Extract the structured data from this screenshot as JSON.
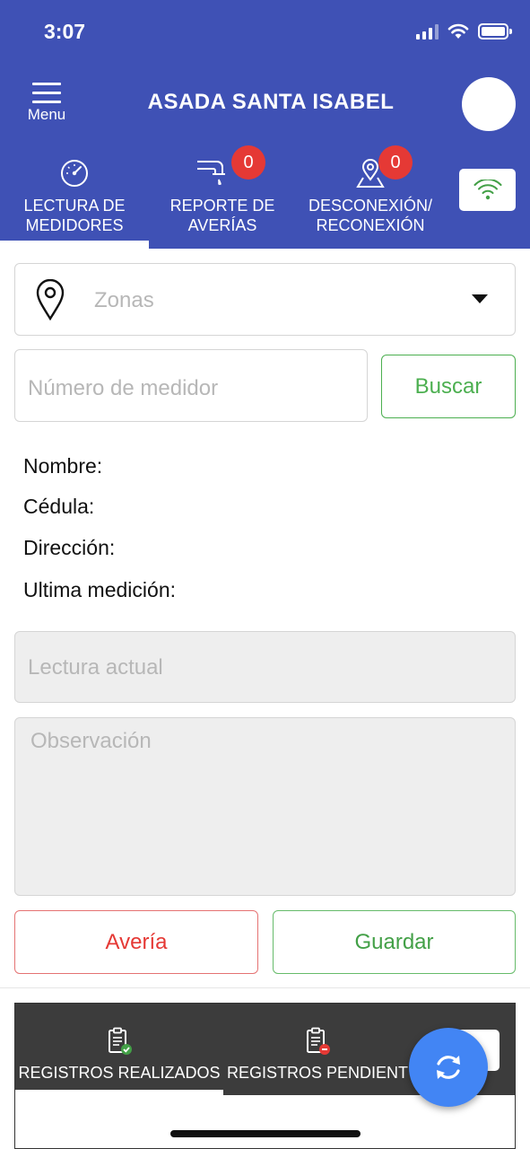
{
  "status_bar": {
    "time": "3:07"
  },
  "header": {
    "menu_label": "Menu",
    "title": "ASADA SANTA ISABEL"
  },
  "tabs": [
    {
      "label_line1": "LECTURA DE",
      "label_line2": "MEDIDORES",
      "icon": "gauge-icon",
      "active": true
    },
    {
      "label_line1": "REPORTE DE",
      "label_line2": "AVERÍAS",
      "icon": "pipe-leak-icon",
      "badge": "0"
    },
    {
      "label_line1": "DESCONEXIÓN/",
      "label_line2": "RECONEXIÓN",
      "icon": "map-pin-icon",
      "badge": "0"
    }
  ],
  "form": {
    "zone_placeholder": "Zonas",
    "meter_placeholder": "Número de medidor",
    "search_label": "Buscar",
    "info": {
      "nombre": "Nombre:",
      "cedula": "Cédula:",
      "direccion": "Dirección:",
      "ultima": "Ultima medición:"
    },
    "reading_placeholder": "Lectura actual",
    "observation_placeholder": "Observación",
    "averia_label": "Avería",
    "save_label": "Guardar"
  },
  "records": {
    "tabs": [
      {
        "label": "REGISTROS REALIZADOS",
        "active": true
      },
      {
        "label": "REGISTROS PENDIENT"
      }
    ]
  },
  "colors": {
    "primary": "#3f51b5",
    "badge": "#e53935",
    "success": "#43a047",
    "danger": "#e53935",
    "fab": "#4285f4"
  }
}
